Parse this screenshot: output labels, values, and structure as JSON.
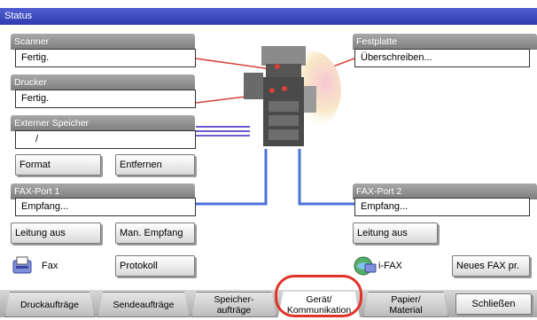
{
  "window": {
    "title": "Status"
  },
  "scanner": {
    "label": "Scanner",
    "value": "Fertig."
  },
  "drucker": {
    "label": "Drucker",
    "value": "Fertig."
  },
  "externer_speicher": {
    "label": "Externer Speicher",
    "value": "/",
    "format_label": "Format",
    "entfernen_label": "Entfernen"
  },
  "festplatte": {
    "label": "Festplatte",
    "value": "Überschreiben..."
  },
  "fax_port_1": {
    "label": "FAX-Port 1",
    "value": "Empfang...",
    "leitung_aus_label": "Leitung aus",
    "man_empfang_label": "Man. Empfang"
  },
  "fax_port_2": {
    "label": "FAX-Port 2",
    "value": "Empfang...",
    "leitung_aus_label": "Leitung aus"
  },
  "fax": {
    "label": "Fax",
    "icon": "fax-icon",
    "protokoll_label": "Protokoll"
  },
  "ifax": {
    "label": "i-FAX",
    "icon": "ifax-icon",
    "neues_fax_label": "Neues FAX pr."
  },
  "tabs": [
    {
      "line1": "Druckaufträge",
      "line2": ""
    },
    {
      "line1": "Sendeaufträge",
      "line2": ""
    },
    {
      "line1": "Speicher-",
      "line2": "aufträge"
    },
    {
      "line1": "Gerät/",
      "line2": "Kommunikation"
    },
    {
      "line1": "Papier/",
      "line2": "Material"
    }
  ],
  "close_label": "Schließen",
  "colors": {
    "title_bar": "#3a46c0",
    "highlight": "#e2332a",
    "lines": "#4a73d8"
  }
}
